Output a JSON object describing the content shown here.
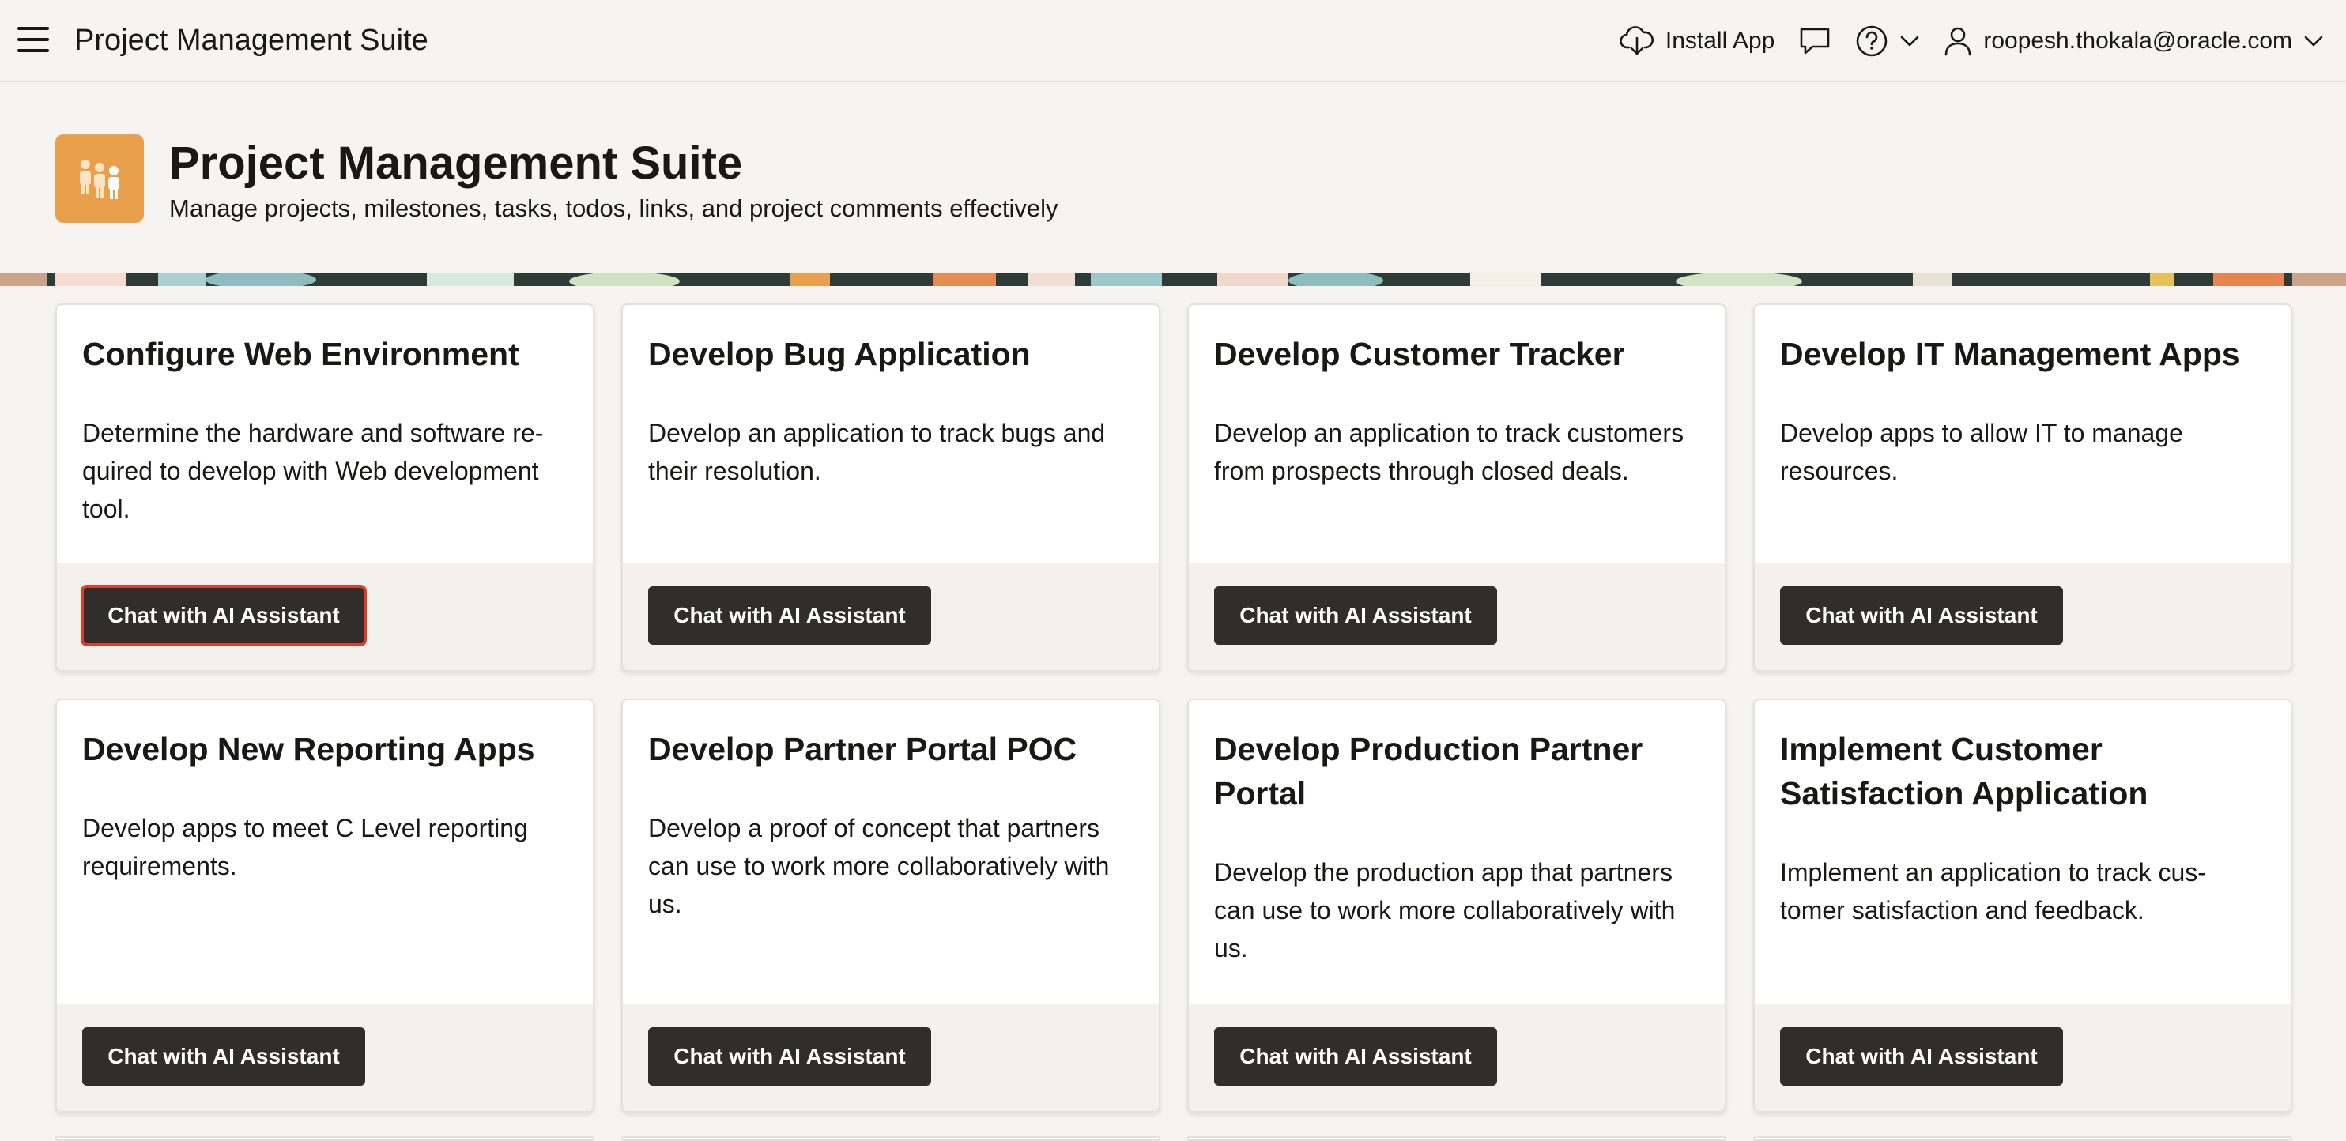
{
  "header": {
    "app_title": "Project Management Suite",
    "install_label": "Install App",
    "user_label": "roopesh.thokala@oracle.com"
  },
  "hero": {
    "title": "Project Management Suite",
    "subtitle": "Manage projects, milestones, tasks, todos, links, and project comments effectively",
    "logo_color": "#e9a04d"
  },
  "cards": [
    {
      "title": "Configure Web Environment",
      "desc": "Determine the hardware and software re-quired to develop with Web development tool.",
      "button": "Chat with AI Assistant"
    },
    {
      "title": "Develop Bug Application",
      "desc": "Develop an application to track bugs and their resolution.",
      "button": "Chat with AI Assistant"
    },
    {
      "title": "Develop Customer Tracker",
      "desc": "Develop an application to track customers from prospects through closed deals.",
      "button": "Chat with AI Assistant"
    },
    {
      "title": "Develop IT Management Apps",
      "desc": "Develop apps to allow IT to manage resources.",
      "button": "Chat with AI Assistant"
    },
    {
      "title": "Develop New Reporting Apps",
      "desc": "Develop apps to meet C Level reporting requirements.",
      "button": "Chat with AI Assistant"
    },
    {
      "title": "Develop Partner Portal POC",
      "desc": "Develop a proof of concept that partners can use to work more collaboratively with us.",
      "button": "Chat with AI Assistant"
    },
    {
      "title": "Develop Production Partner Portal",
      "desc": "Develop the production app that partners can use to work more collaboratively with us.",
      "button": "Chat with AI Assistant"
    },
    {
      "title": "Implement Customer Satisfaction Application",
      "desc": "Implement an application to track cus-tomer satisfaction and feedback.",
      "button": "Chat with AI Assistant"
    }
  ],
  "colors": {
    "button_bg": "#312d2a",
    "focus_outline": "#d9402a",
    "page_bg": "#f5f4f2"
  }
}
